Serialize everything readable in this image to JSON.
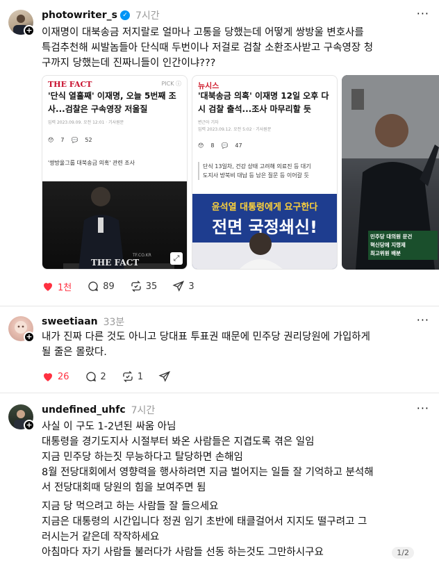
{
  "posts": [
    {
      "username": "photowriter_s",
      "time": "7시간",
      "verified": true,
      "text": "이재명이 대북송금 저지랄로 얼마나 고통을 당했는데 어떻게 쌍방울 변호사를\n특검추천해 씨발놈들아 단식때 두번이나 저걸로 검찰 소환조사받고 구속영장 청\n구까지 당했는데 진짜니들이 인간이냐???",
      "likes": "1천",
      "comments": "89",
      "reposts": "35",
      "shares": "3",
      "media": [
        {
          "brand": "THE FACT",
          "pick": "PICK ⓘ",
          "headline": "'단식 열흘째' 이재명, 오늘 5번째 조사...검찰은 구속영장 저울질",
          "meta": "입력 2023.09.09. 오전 12:01 · 기사원문",
          "reactions": "7",
          "comments": "52",
          "sub": "'쌍방울그룹 대북송금 의혹' 관련 조사",
          "watermark": "THE FACT",
          "small_credit": "TF.CO.KR"
        },
        {
          "brand": "뉴시스",
          "headline": "'대북송금 의혹' 이재명 12일 오후 다시 검찰 출석...조사 마무리할 듯",
          "meta": "변근아 기자",
          "meta2": "입력 2023.09.12. 오전 5:02 · 기사원문",
          "reactions": "8",
          "comments": "47",
          "sub": "단식 13일차, 건강 상태 고려해 의료진 등 대기\n도지사 방북비 대납 등 남은 질문 등 이어갈 듯",
          "banner_top": "윤석열 대통령에게 요구한다",
          "banner_main": "전면 국정쇄신!"
        },
        {
          "sign_text": "민주당 대의원 문건\n혁신당에 지령제\n최고위원 배분"
        }
      ]
    },
    {
      "username": "sweetiaan",
      "time": "33분",
      "text": "내가 진짜 다른 것도 아니고 당대표 투표권 때문에 민주당 권리당원에 가입하게\n될 줄은 몰랐다.",
      "likes": "26",
      "comments": "2",
      "reposts": "1"
    },
    {
      "username": "undefined_uhfc",
      "time": "7시간",
      "text": "사실 이 구도 1-2년된 싸움 아님\n대통령을 경기도지사 시절부터 봐온 사람들은 지겹도록 겪은 일임\n지금 민주당 하는짓 무능하다고 탈당하면 손해임\n8월 전당대회에서 영향력을 행사하려면 지금 벌어지는 일들 잘 기억하고 분석해\n서 전당대회때 당원의 힘을 보여주면 됨",
      "text2": "지금 당 먹으려고 하는 사람들 잘 들으세요\n지금은 대통령의 시간입니다 정권 임기 초반에 태클걸어서 지지도 떨구려고 그\n러시는거 같은데 작작하세요\n아침마다 자기 사람들 불러다가 사람들 선동 하는것도 그만하시구요",
      "pager": "1/2"
    }
  ],
  "colors": {
    "like_red": "#ff3040",
    "verified_blue": "#0095f6",
    "muted": "#9a9a9a"
  }
}
